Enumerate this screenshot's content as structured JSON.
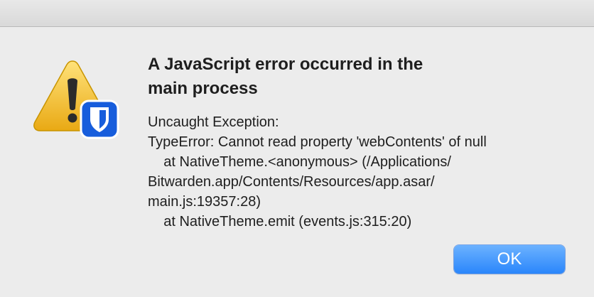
{
  "dialog": {
    "icon": "warning-icon",
    "badge_icon": "bitwarden-shield-icon",
    "title": "A JavaScript error occurred in the\nmain process",
    "message_lines": [
      "Uncaught Exception:",
      "TypeError: Cannot read property 'webContents' of null",
      "    at NativeTheme.<anonymous> (/Applications/",
      "Bitwarden.app/Contents/Resources/app.asar/",
      "main.js:19357:28)",
      "    at NativeTheme.emit (events.js:315:20)"
    ],
    "ok_label": "OK"
  },
  "colors": {
    "background": "#ececec",
    "warning_yellow": "#f3c534",
    "badge_blue": "#175ddc",
    "button_blue": "#2a86fb"
  }
}
